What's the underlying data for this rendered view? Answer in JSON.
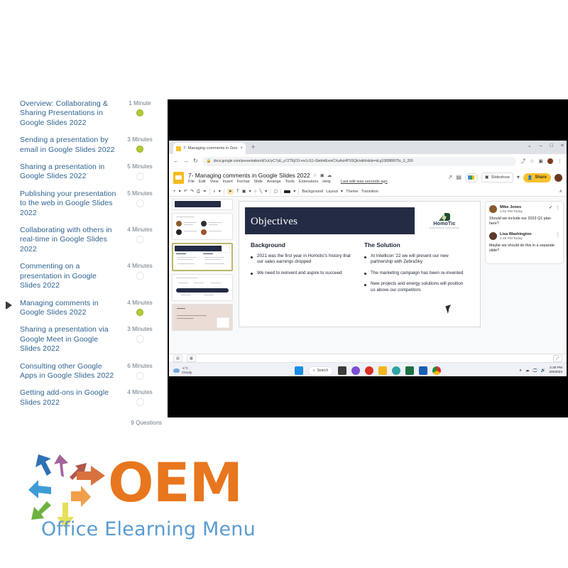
{
  "curriculum": {
    "lessons": [
      {
        "title": "Overview: Collaborating & Sharing Presentations in Google Slides 2022",
        "duration": "1 Minute",
        "status": "done",
        "active": false
      },
      {
        "title": "Sending a presentation by email in Google Slides 2022",
        "duration": "3 Minutes",
        "status": "done",
        "active": false
      },
      {
        "title": "Sharing a presentation in Google Slides 2022",
        "duration": "5 Minutes",
        "status": "todo",
        "active": false
      },
      {
        "title": "Publishing your presentation to the web in Google Slides 2022",
        "duration": "5 Minutes",
        "status": "todo",
        "active": false
      },
      {
        "title": "Collaborating with others in real-time in Google Slides 2022",
        "duration": "4 Minutes",
        "status": "todo",
        "active": false
      },
      {
        "title": "Commenting on a presentation in Google Slides 2022",
        "duration": "4 Minutes",
        "status": "todo",
        "active": false
      },
      {
        "title": "Managing comments in Google Slides 2022",
        "duration": "4 Minutes",
        "status": "done",
        "active": true
      },
      {
        "title": "Sharing a presentation via Google Meet in Google Slides 2022",
        "duration": "3 Minutes",
        "status": "todo",
        "active": false
      },
      {
        "title": "Consulting other Google Apps in Google Slides 2022",
        "duration": "6 Minutes",
        "status": "todo",
        "active": false
      },
      {
        "title": "Getting add-ons in Google Slides 2022",
        "duration": "4 Minutes",
        "status": "todo",
        "active": false
      }
    ],
    "footer_note": "9 Questions"
  },
  "browser": {
    "tab_title": "7- Managing comments in Goo",
    "tab_close": "×",
    "new_tab": "+",
    "window_controls": [
      "⌄",
      "–",
      "□",
      "×"
    ],
    "back": "←",
    "forward": "→",
    "reload": "↻",
    "lock": "🔒",
    "url": "docs.google.com/presentation/d/1uUyC7yE_p7ZTEjO3-mx1cS1-GbdmlEvmCXuAuHPSSQk/odit#slide=id.g1589f86f75c_0_269",
    "share_icon": "⤴",
    "star_icon": "☆",
    "extensions_icon": "▣",
    "profile_icon": "●",
    "menu_icon": "⋮"
  },
  "slides_app": {
    "doc_title": "7- Managing comments in Google Slides 2022",
    "title_icons": [
      "☆",
      "▣",
      "☁"
    ],
    "menu": [
      "File",
      "Edit",
      "View",
      "Insert",
      "Format",
      "Slide",
      "Arrange",
      "Tools",
      "Extensions",
      "Help"
    ],
    "last_edit": "Last edit was seconds ago",
    "trending_icon": "↗",
    "comment_history_icon": "▤",
    "meet_label": "▾",
    "slideshow_label": "Slideshow",
    "slideshow_caret": "▾",
    "share_label": "Share",
    "share_icon": "👤",
    "toolbar": {
      "add_slide": "+",
      "add_caret": "▾",
      "undo": "↶",
      "redo": "↷",
      "print": "⎙",
      "paint": "✒",
      "zoom": "⌕",
      "zoom_caret": "▾",
      "select": "➤",
      "textbox": "T",
      "image": "▣",
      "image_caret": "▾",
      "shape": "○",
      "line": "╲",
      "line_caret": "▾",
      "comment": "▢",
      "fill_caret": "▾",
      "background": "Background",
      "layout": "Layout",
      "layout_caret": "▾",
      "theme": "Theme",
      "transition": "Transition",
      "collapse": "∧"
    },
    "footer": {
      "speaker_notes": "▤",
      "grid": "▦",
      "expand": "⤢"
    }
  },
  "slide": {
    "title": "Objectives",
    "logo_name": "HomoTic",
    "logo_sub": "ELECTRONICS & SOLUTIONS",
    "columns": [
      {
        "heading": "Background",
        "bullets": [
          "2021 was the first year in Homotic's history that our sales earnings dropped",
          "We need to reinvent and aspire to succeed"
        ]
      },
      {
        "heading": "The Solution",
        "bullets": [
          "At Intellicon '22 we will present our new partnership with ZebraSky",
          "The marketing campaign has been re-invented",
          "New projects and energy solutions will position us above our competitors"
        ]
      }
    ]
  },
  "comments": [
    {
      "author": "Mike Jones",
      "time": "1:52 PM Today",
      "text": "Should we include our 2023 Q1 plan here?",
      "resolve_icon": "✓",
      "more_icon": "⋮",
      "avatar_color": "#8a5a2b"
    },
    {
      "author": "Lisa Washington",
      "time": "2:28 PM Today",
      "text": "Maybe we should do this in a separate slide?",
      "resolve_icon": "",
      "more_icon": "⋮",
      "avatar_color": "#5c3b2e"
    }
  ],
  "taskbar": {
    "weather_temp": "-1°C",
    "weather_desc": "Cloudy",
    "search_label": "Search",
    "search_icon": "⌕",
    "tray_icons": [
      "∧",
      "☁",
      "🗔",
      "🔊"
    ],
    "time": "2:30 PM",
    "date": "2/6/2023"
  },
  "brand": {
    "title": "OEM",
    "subtitle": "Office Elearning Menu",
    "accent": "#e8761e",
    "subtitle_color": "#5b9bd1"
  }
}
